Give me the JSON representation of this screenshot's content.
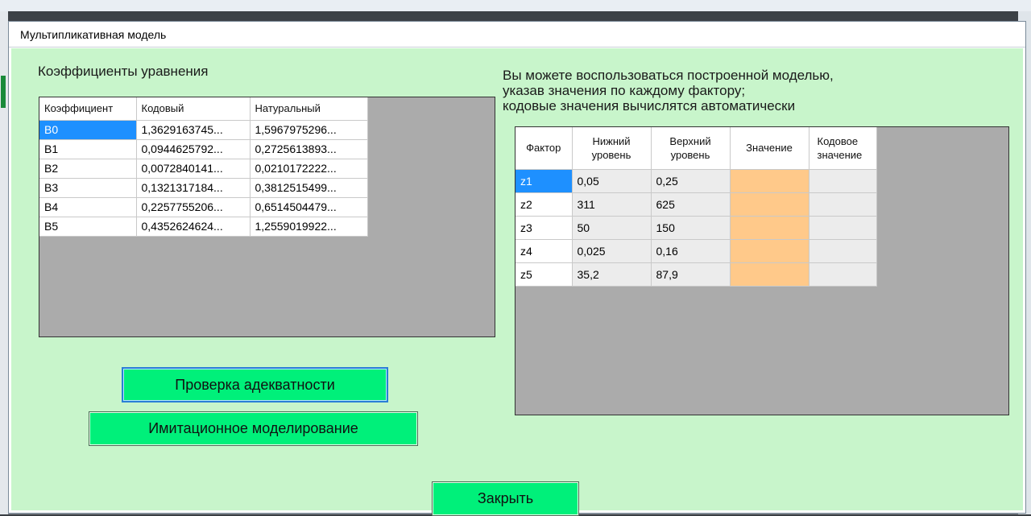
{
  "window": {
    "title": "Мультипликативная модель"
  },
  "coefficients": {
    "heading": "Коэффициенты уравнения",
    "columns": [
      "Коэффициент",
      "Кодовый",
      "Натуральный"
    ],
    "rows": [
      {
        "name": "B0",
        "coded": "1,3629163745...",
        "natural": "1,5967975296..."
      },
      {
        "name": "B1",
        "coded": "0,0944625792...",
        "natural": "0,2725613893..."
      },
      {
        "name": "B2",
        "coded": "0,0072840141...",
        "natural": "0,0210172222..."
      },
      {
        "name": "B3",
        "coded": "0,1321317184...",
        "natural": "0,3812515499..."
      },
      {
        "name": "B4",
        "coded": "0,2257755206...",
        "natural": "0,6514504479..."
      },
      {
        "name": "B5",
        "coded": "0,4352624624...",
        "natural": "1,2559019922..."
      }
    ]
  },
  "model_use": {
    "text_line1": "Вы можете воспользоваться построенной моделью,",
    "text_line2": "указав значения по каждому фактору;",
    "text_line3": "кодовые значения вычислятся автоматически",
    "columns": [
      {
        "line1": "Фактор",
        "line2": ""
      },
      {
        "line1": "Нижний",
        "line2": "уровень"
      },
      {
        "line1": "Верхний",
        "line2": "уровень"
      },
      {
        "line1": "Значение",
        "line2": ""
      },
      {
        "line1": "Кодовое",
        "line2": "значение"
      }
    ],
    "rows": [
      {
        "factor": "z1",
        "lower": "0,05",
        "upper": "0,25",
        "value": "",
        "coded": ""
      },
      {
        "factor": "z2",
        "lower": "311",
        "upper": "625",
        "value": "",
        "coded": ""
      },
      {
        "factor": "z3",
        "lower": "50",
        "upper": "150",
        "value": "",
        "coded": ""
      },
      {
        "factor": "z4",
        "lower": "0,025",
        "upper": "0,16",
        "value": "",
        "coded": ""
      },
      {
        "factor": "z5",
        "lower": "35,2",
        "upper": "87,9",
        "value": "",
        "coded": ""
      }
    ]
  },
  "buttons": {
    "adequacy": "Проверка адекватности",
    "simulation": "Имитационное моделирование",
    "close": "Закрыть"
  },
  "colors": {
    "client_bg": "#c8f5cb",
    "button_bg": "#00f07a",
    "selected_row_header": "#1e90ff",
    "value_cell": "#ffc98a",
    "grid_empty": "#ababab"
  }
}
